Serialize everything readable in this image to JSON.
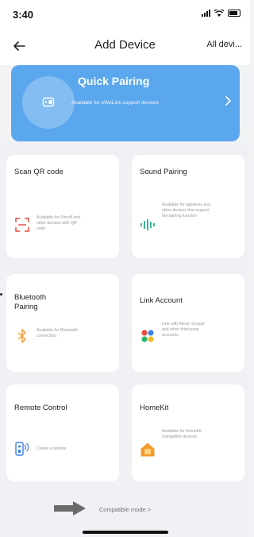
{
  "status_bar": {
    "time": "3:40"
  },
  "nav": {
    "title": "Add Device",
    "right_label": "All devi..."
  },
  "quick_pairing": {
    "title": "Quick Pairing",
    "subtitle": "Available for eWeLink support devices",
    "icon": "device-icon",
    "color": "#5ba7ee"
  },
  "cards": [
    {
      "title": "Scan QR code",
      "desc": "Available for Sonoff and other devices with QR code",
      "icon": "qr-scan-icon"
    },
    {
      "title": "Sound Pairing",
      "desc": "Available for speakers and other devices that support the pairing function",
      "icon": "soundwave-icon"
    },
    {
      "title": "Bluetooth Pairing",
      "desc": "Available for Bluetooth connection",
      "icon": "bluetooth-icon"
    },
    {
      "title": "Link Account",
      "desc": "Link with Alexa, Google and other third-party accounts",
      "icon": "link-account-icon"
    },
    {
      "title": "Remote Control",
      "desc": "Create a remote",
      "icon": "remote-control-icon"
    },
    {
      "title": "HomeKit",
      "desc": "Available for HomeKit compatible devices",
      "icon": "homekit-icon"
    }
  ],
  "compatible_mode": {
    "label": "Compatible mode >"
  }
}
